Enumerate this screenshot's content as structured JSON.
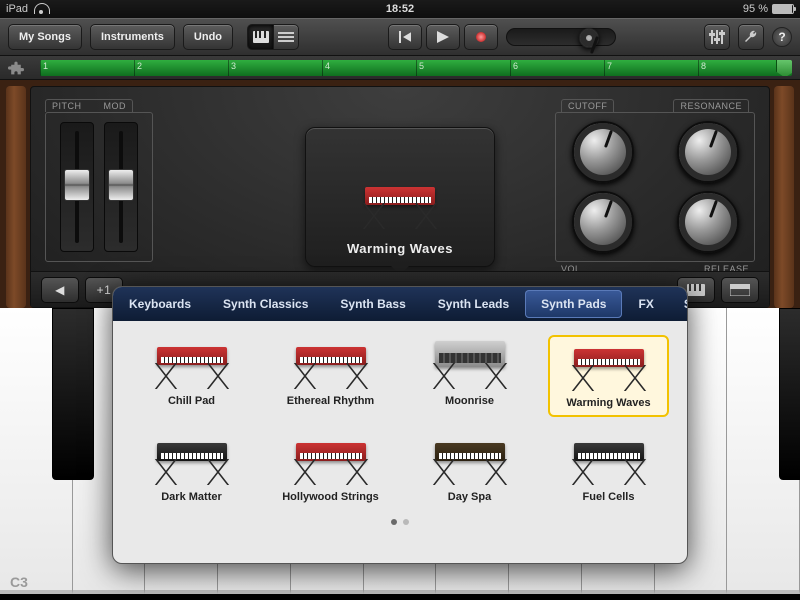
{
  "status": {
    "device": "iPad",
    "time": "18:52",
    "battery": "95 %"
  },
  "toolbar": {
    "my_songs": "My Songs",
    "instruments": "Instruments",
    "undo": "Undo"
  },
  "ruler": {
    "bars": [
      "1",
      "2",
      "3",
      "4",
      "5",
      "6",
      "7",
      "8"
    ]
  },
  "panel": {
    "pitch_label": "PITCH",
    "mod_label": "MOD",
    "preset_name": "Warming Waves",
    "cutoff_label": "CUTOFF",
    "resonance_label": "RESONANCE",
    "vol_label": "VOL",
    "release_label": "RELEASE",
    "octave_up": "+1",
    "octave_marker": "C3"
  },
  "popover": {
    "tabs": [
      "Keyboards",
      "Synth Classics",
      "Synth Bass",
      "Synth Leads",
      "Synth Pads",
      "FX"
    ],
    "selected_tab": "Synth Pads",
    "save": "Save",
    "presets": [
      {
        "label": "Chill Pad",
        "style": "red"
      },
      {
        "label": "Ethereal Rhythm",
        "style": "red"
      },
      {
        "label": "Moonrise",
        "style": "rack"
      },
      {
        "label": "Warming Waves",
        "style": "red",
        "selected": true
      },
      {
        "label": "Dark Matter",
        "style": "dark"
      },
      {
        "label": "Hollywood Strings",
        "style": "red"
      },
      {
        "label": "Day Spa",
        "style": "mini"
      },
      {
        "label": "Fuel Cells",
        "style": "dark"
      }
    ],
    "page_index": 0,
    "page_count": 2
  }
}
